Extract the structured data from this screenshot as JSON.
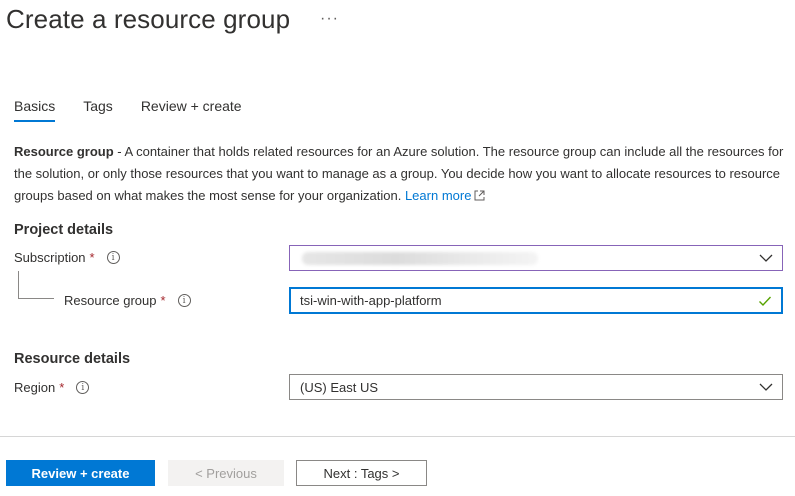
{
  "header": {
    "title": "Create a resource group",
    "more": "···"
  },
  "tabs": [
    {
      "label": "Basics",
      "active": true
    },
    {
      "label": "Tags",
      "active": false
    },
    {
      "label": "Review + create",
      "active": false
    }
  ],
  "description": {
    "term": "Resource group",
    "text": " - A container that holds related resources for an Azure solution. The resource group can include all the resources for the solution, or only those resources that you want to manage as a group. You decide how you want to allocate resources to resource groups based on what makes the most sense for your organization. ",
    "link": "Learn more"
  },
  "project_details": {
    "title": "Project details",
    "subscription_label": "Subscription",
    "subscription_value": "",
    "resource_group_label": "Resource group",
    "resource_group_value": "tsi-win-with-app-platform"
  },
  "resource_details": {
    "title": "Resource details",
    "region_label": "Region",
    "region_value": "(US) East US"
  },
  "required_marker": "*",
  "info_glyph": "i",
  "footer": {
    "review_create": "Review + create",
    "previous": "< Previous",
    "next": "Next : Tags >"
  },
  "colors": {
    "accent": "#0078d4",
    "required": "#a4262c",
    "valid": "#57a300",
    "subscription_border": "#8764b8"
  }
}
